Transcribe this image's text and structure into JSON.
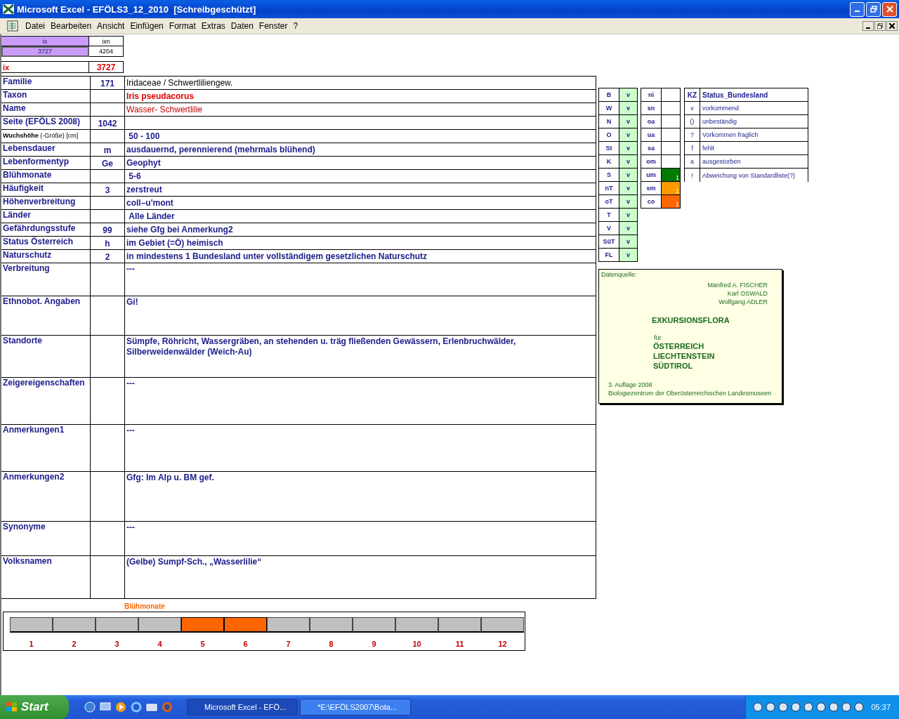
{
  "window": {
    "title": "Microsoft Excel - EFÖLS3_12_2010  [Schreibgeschützt]"
  },
  "menu": [
    "Datei",
    "Bearbeiten",
    "Ansicht",
    "Einfügen",
    "Format",
    "Extras",
    "Daten",
    "Fenster",
    "?"
  ],
  "index_cells": {
    "header_1": "ix",
    "header_2": "ixn",
    "value_1": "3727",
    "value_2": "4204",
    "label": "ix",
    "current": "3727"
  },
  "rows": [
    {
      "label": "Familie",
      "code": "171",
      "value": "Iridaceae  /  Schwertliliengew.",
      "kind": "plain"
    },
    {
      "label": "Taxon",
      "code": "",
      "value": "Iris pseudacorus",
      "kind": "red-bold"
    },
    {
      "label": "Name",
      "code": "",
      "value": "Wasser- Schwertlilie",
      "kind": "red"
    },
    {
      "label": "Seite (EFÖLS 2008)",
      "code": "1042",
      "value": ""
    },
    {
      "label": "**Wuchshöhe** (-Größe) [cm]",
      "code": "",
      "value": " 50 - 100",
      "kind": "bold",
      "label_bold": false
    },
    {
      "label": "Lebensdauer",
      "code": "m",
      "value": "ausdauernd, perennierend (mehrmals blühend)",
      "kind": "bold"
    },
    {
      "label": "Lebenformentyp",
      "code": "Ge",
      "value": "Geophyt",
      "kind": "bold"
    },
    {
      "label": "Blühmonate",
      "code": "",
      "value": " 5-6",
      "kind": "bold"
    },
    {
      "label": "Häufigkeit",
      "code": "3",
      "value": "zerstreut",
      "kind": "bold"
    },
    {
      "label": "Höhenverbreitung",
      "code": "",
      "value": "coll–u'mont",
      "kind": "bold"
    },
    {
      "label": "Länder",
      "code": "",
      "value": " Alle Länder",
      "kind": "bold"
    },
    {
      "label": "Gefährdungsstufe",
      "code": "99",
      "value": "siehe Gfg bei Anmerkung2",
      "kind": "bold"
    },
    {
      "label": "Status Österreich",
      "code": "h",
      "value": "im Gebiet (=Ö) heimisch",
      "kind": "bold"
    },
    {
      "label": "Naturschutz",
      "code": "2",
      "value": "in mindestens 1 Bundesland unter vollständigem gesetzlichen Naturschutz",
      "kind": "bold"
    }
  ],
  "notes": [
    {
      "label": "Verbreitung",
      "value": " ---"
    },
    {
      "label": "Ethnobot. Angaben",
      "value": "Gi!"
    },
    {
      "label": "Standorte",
      "value": "Sümpfe, Röhricht, Wassergräben, an stehenden u. träg fließenden Gewässern, Erlenbruchwälder, Silberweidenwälder (Weich-Au)"
    },
    {
      "label": "Zeigereigenschaften",
      "value": "---"
    },
    {
      "label": "Anmerkungen1",
      "value": "---"
    },
    {
      "label": "Anmerkungen2",
      "value": "Gfg:  Im Alp u. BM gef."
    },
    {
      "label": "Synonyme",
      "value": "---"
    },
    {
      "label": "Volksnamen",
      "value": "(Gelbe) Sumpf-Sch., „Wasserlilie“"
    }
  ],
  "states": [
    {
      "code": "B",
      "status": "v"
    },
    {
      "code": "W",
      "status": "v"
    },
    {
      "code": "N",
      "status": "v"
    },
    {
      "code": "O",
      "status": "v"
    },
    {
      "code": "St",
      "status": "v"
    },
    {
      "code": "K",
      "status": "v"
    },
    {
      "code": "S",
      "status": "v"
    },
    {
      "code": "nT",
      "status": "v"
    },
    {
      "code": "oT",
      "status": "v"
    },
    {
      "code": "T",
      "status": "v"
    },
    {
      "code": "V",
      "status": "v"
    },
    {
      "code": "SüT",
      "status": "v"
    },
    {
      "code": "FL",
      "status": "v"
    }
  ],
  "zones": [
    {
      "code": "ni"
    },
    {
      "code": "sn"
    },
    {
      "code": "oa"
    },
    {
      "code": "ua"
    },
    {
      "code": "sa"
    },
    {
      "code": "om"
    },
    {
      "code": "um",
      "color": "#007a00",
      "note": "1"
    },
    {
      "code": "sm",
      "color": "#ff9900",
      "note": "1"
    },
    {
      "code": "co",
      "color": "#ff6600",
      "note": "1"
    }
  ],
  "legend": {
    "header_1": "KZ",
    "header_2": "Status_Bundesland",
    "items": [
      {
        "code": "v",
        "text": "vorkommend"
      },
      {
        "code": "()",
        "text": "unbeständig"
      },
      {
        "code": "?",
        "text": "Vorkommen fraglich"
      },
      {
        "code": "f",
        "text": "fehlt"
      },
      {
        "code": "a",
        "text": "ausgestorben"
      },
      {
        "code": "!",
        "text": "Abweichung von Standardliste(?)"
      }
    ]
  },
  "source_card": {
    "label": "Datenquelle:",
    "authors": [
      "Manfred A. FISCHER",
      "Karl OSWALD",
      "Wolfgang ADLER"
    ],
    "title": "EXKURSIONSFLORA",
    "for": "für",
    "regions": [
      "ÖSTERREICH",
      "LIECHTENSTEIN",
      "SÜDTIROL"
    ],
    "edition": "3. Auflage 2008",
    "publisher": "Biologiezentrum der Oberösterreichischen Landesmuseen"
  },
  "bloom": {
    "title": "Blühmonate",
    "months": [
      {
        "label": "1",
        "on": false
      },
      {
        "label": "2",
        "on": false
      },
      {
        "label": "3",
        "on": false
      },
      {
        "label": "4",
        "on": false
      },
      {
        "label": "5",
        "on": true
      },
      {
        "label": "6",
        "on": true
      },
      {
        "label": "7",
        "on": false
      },
      {
        "label": "8",
        "on": false
      },
      {
        "label": "9",
        "on": false
      },
      {
        "label": "10",
        "on": false
      },
      {
        "label": "11",
        "on": false
      },
      {
        "label": "12",
        "on": false
      }
    ]
  },
  "taskbar": {
    "start": "Start",
    "tasks": [
      {
        "label": "Microsoft Excel - EFÖ...",
        "selected": true
      },
      {
        "label": "*E:\\EFÖLS2007\\Bota...",
        "selected": false
      }
    ],
    "clock": "05:37"
  }
}
